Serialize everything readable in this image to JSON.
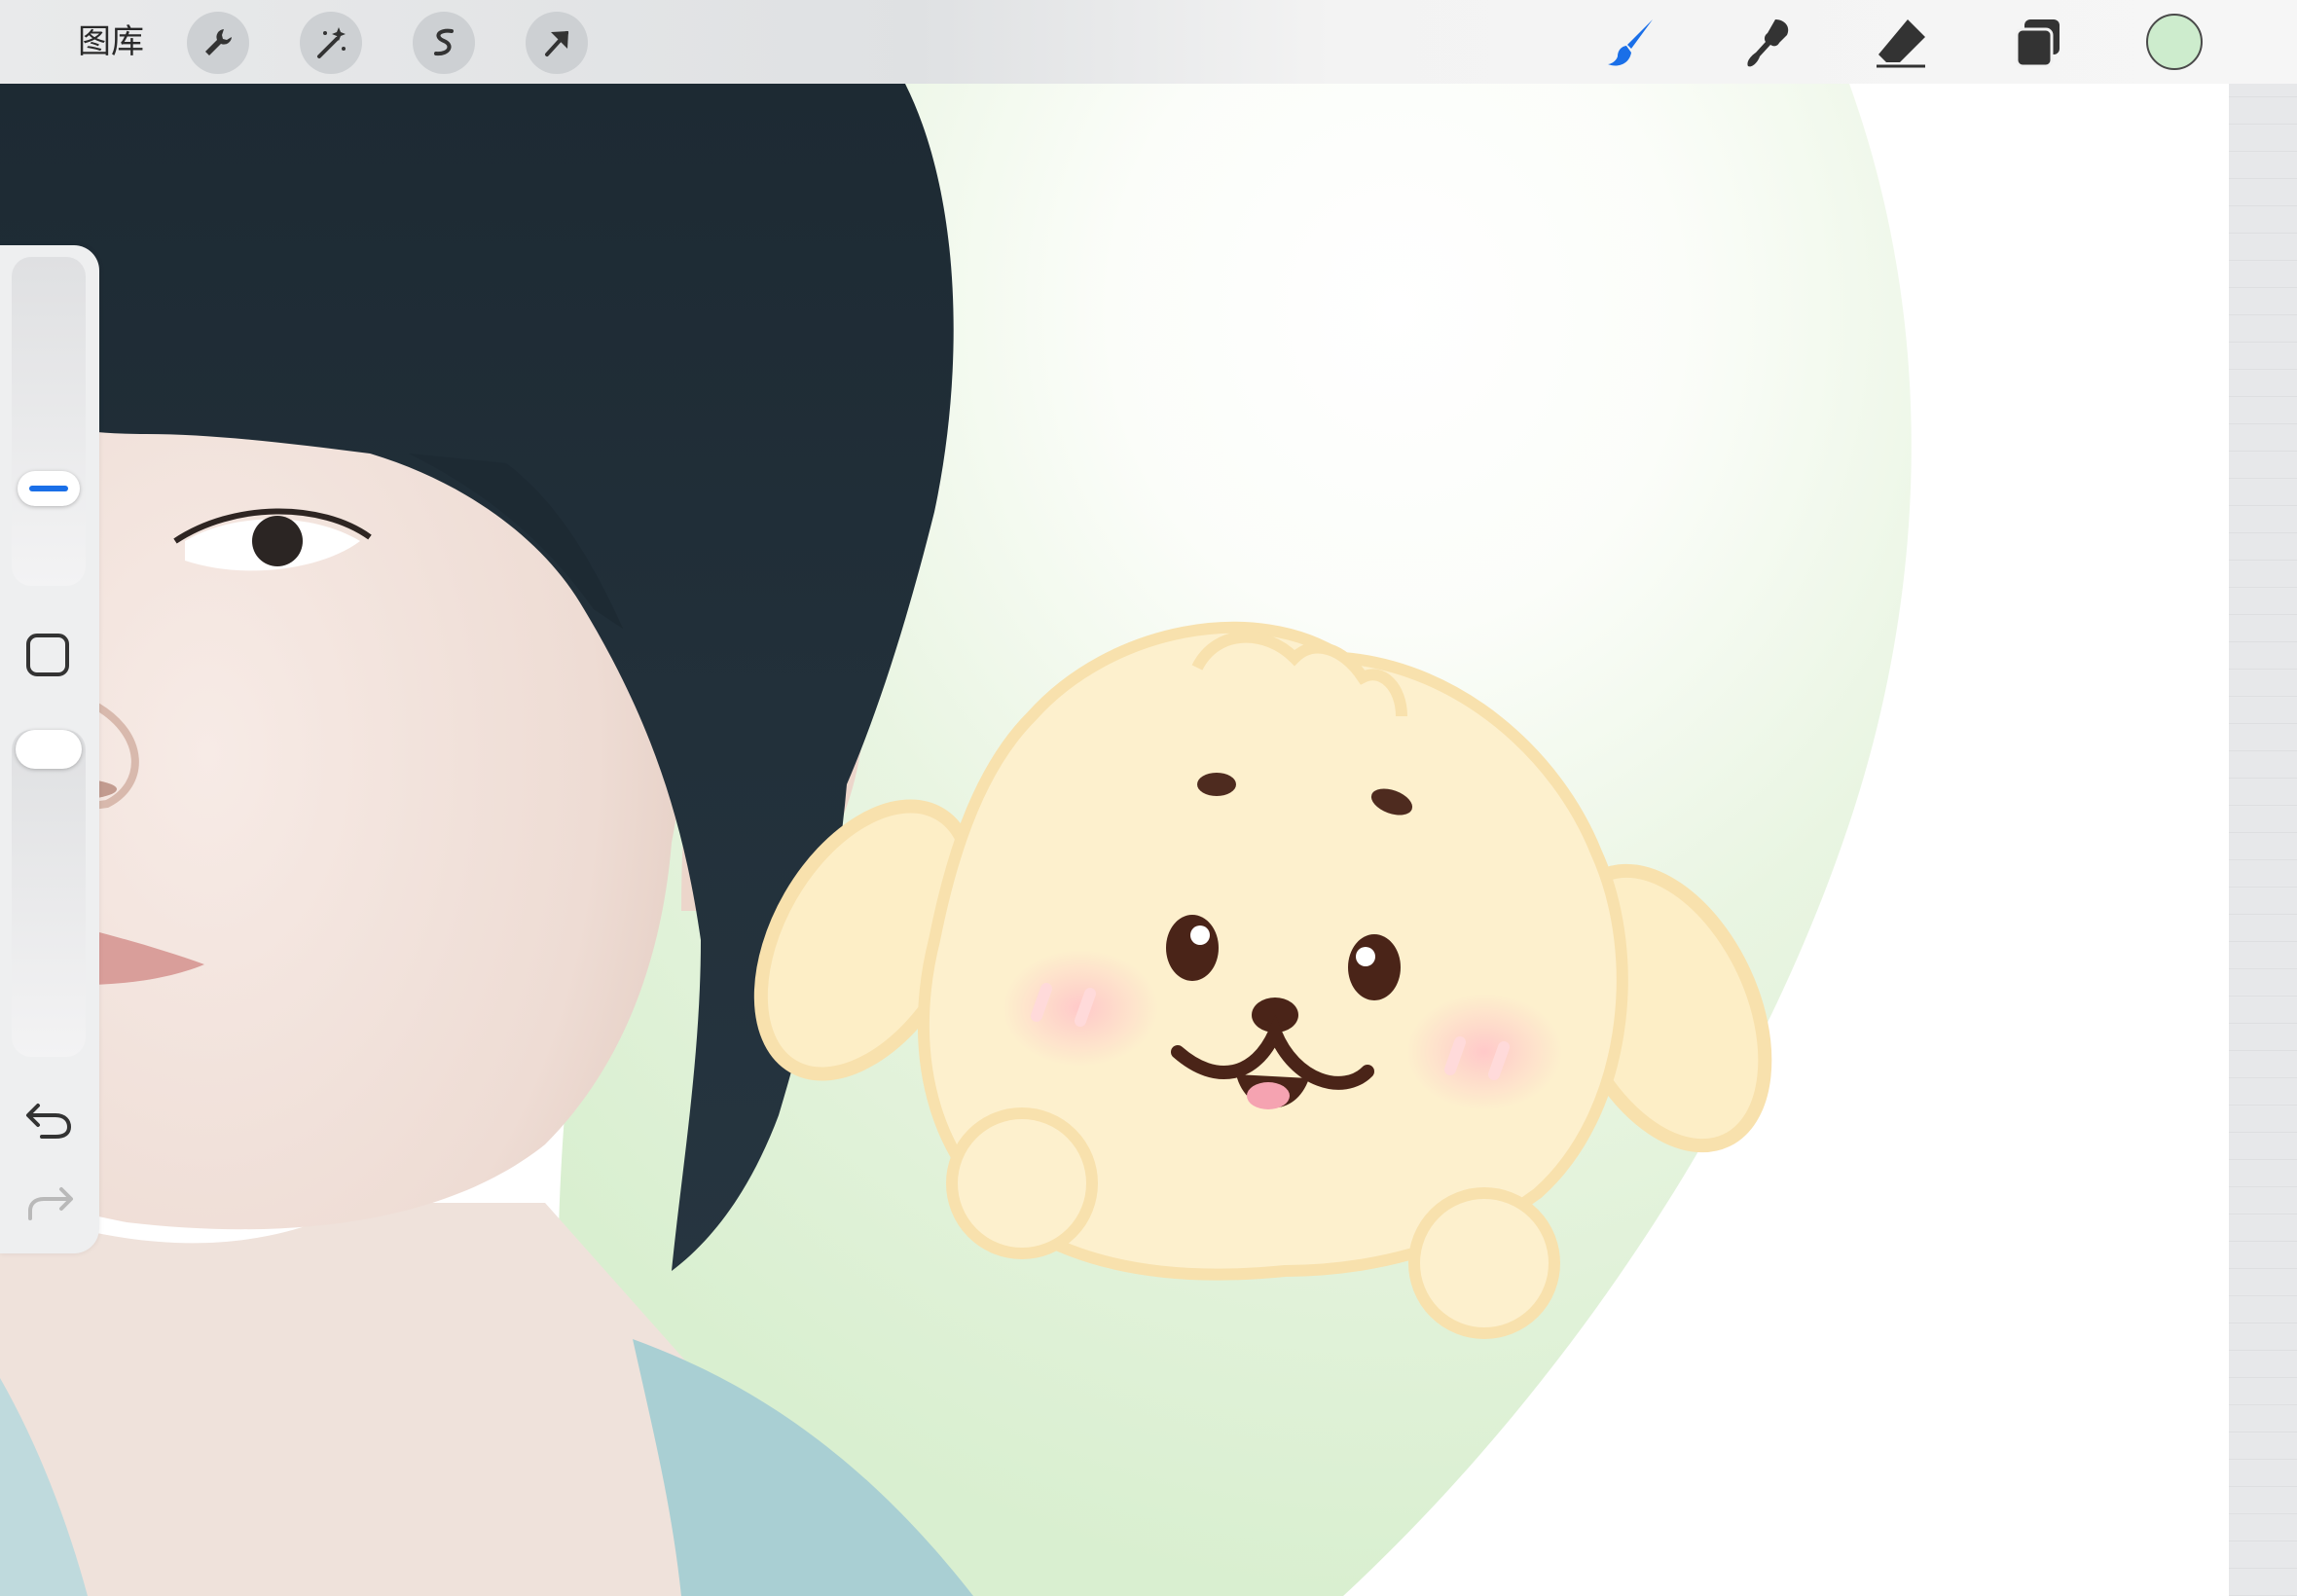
{
  "toolbar": {
    "gallery_label": "图库",
    "left_tools": [
      "wrench-icon",
      "magic-wand-icon",
      "selection-s-icon",
      "transform-arrow-icon"
    ],
    "right_tools": [
      "brush-icon",
      "smudge-icon",
      "eraser-icon",
      "layers-icon"
    ],
    "active_tool": "brush-icon",
    "accent_color": "#1a6fe8",
    "current_color": "#cdeccd"
  },
  "sidebar": {
    "brush_size_slider": "brush-size-slider",
    "opacity_slider": "opacity-slider",
    "modify_button": "modify-square-icon",
    "undo": "undo-icon",
    "redo": "redo-icon"
  }
}
